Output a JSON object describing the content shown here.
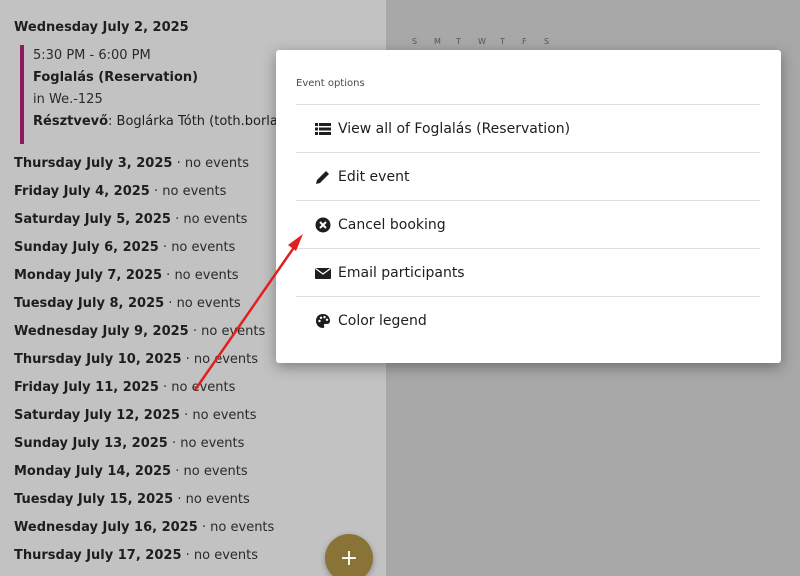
{
  "agenda": {
    "first_day": "Wednesday July 2, 2025",
    "event": {
      "time": "5:30 PM - 6:00 PM",
      "title": "Foglalás (Reservation)",
      "location": "in We.-125",
      "participant_label": "Résztvevő",
      "participant_value": ": Boglárka Tóth (toth.borla"
    },
    "days": [
      {
        "date": "Thursday July 3, 2025",
        "status": " · no events"
      },
      {
        "date": "Friday July 4, 2025",
        "status": " · no events"
      },
      {
        "date": "Saturday July 5, 2025",
        "status": " · no events"
      },
      {
        "date": "Sunday July 6, 2025",
        "status": " · no events"
      },
      {
        "date": "Monday July 7, 2025",
        "status": " · no events"
      },
      {
        "date": "Tuesday July 8, 2025",
        "status": " · no events"
      },
      {
        "date": "Wednesday July 9, 2025",
        "status": " · no events"
      },
      {
        "date": "Thursday July 10, 2025",
        "status": " · no events"
      },
      {
        "date": "Friday July 11, 2025",
        "status": " · no events"
      },
      {
        "date": "Saturday July 12, 2025",
        "status": " · no events"
      },
      {
        "date": "Sunday July 13, 2025",
        "status": " · no events"
      },
      {
        "date": "Monday July 14, 2025",
        "status": " · no events"
      },
      {
        "date": "Tuesday July 15, 2025",
        "status": " · no events"
      },
      {
        "date": "Wednesday July 16, 2025",
        "status": " · no events"
      },
      {
        "date": "Thursday July 17, 2025",
        "status": " · no events"
      }
    ]
  },
  "calendar": {
    "weekdays": [
      "S",
      "M",
      "T",
      "W",
      "T",
      "F",
      "S"
    ]
  },
  "modal": {
    "header": "Event options",
    "options": [
      {
        "label": "View all of Foglalás (Reservation)",
        "icon": "list-icon"
      },
      {
        "label": "Edit event",
        "icon": "pencil-icon"
      },
      {
        "label": "Cancel booking",
        "icon": "cancel-circle-icon"
      },
      {
        "label": "Email participants",
        "icon": "envelope-icon"
      },
      {
        "label": "Color legend",
        "icon": "palette-icon"
      }
    ]
  },
  "fab": {
    "label": "+"
  },
  "colors": {
    "event_accent": "#8c1a5f",
    "fab": "#8a7336",
    "annotation_arrow": "#e02020"
  }
}
